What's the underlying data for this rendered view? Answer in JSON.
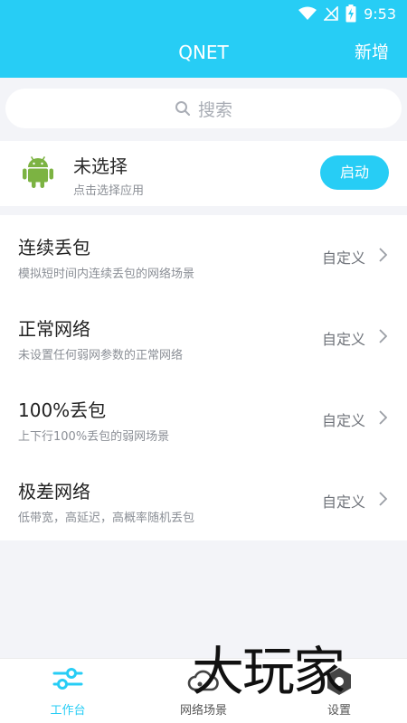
{
  "status_bar": {
    "time": "9:53",
    "icons": [
      "wifi-icon",
      "no-signal-icon",
      "battery-charging-icon"
    ]
  },
  "app_bar": {
    "title": "QNET",
    "action_label": "新增"
  },
  "search": {
    "label": "搜索",
    "icon": "search-icon"
  },
  "app_select": {
    "icon": "android-icon",
    "title": "未选择",
    "subtitle": "点击选择应用",
    "start_label": "启动"
  },
  "scenes": [
    {
      "title": "连续丢包",
      "desc": "模拟短时间内连续丢包的网络场景",
      "custom_label": "自定义"
    },
    {
      "title": "正常网络",
      "desc": "未设置任何弱网参数的正常网络",
      "custom_label": "自定义"
    },
    {
      "title": "100%丢包",
      "desc": "上下行100%丢包的弱网场景",
      "custom_label": "自定义"
    },
    {
      "title": "极差网络",
      "desc": "低带宽，高延迟，高概率随机丢包",
      "custom_label": "自定义"
    }
  ],
  "bottom_nav": [
    {
      "label": "工作台",
      "icon": "sliders-icon",
      "active": true
    },
    {
      "label": "网络场景",
      "icon": "cloud-icon",
      "active": false
    },
    {
      "label": "设置",
      "icon": "hexagon-gear-icon",
      "active": false
    }
  ],
  "watermark": {
    "text": "大玩家"
  },
  "colors": {
    "accent": "#27cdf5",
    "background": "#f3f4f8"
  }
}
